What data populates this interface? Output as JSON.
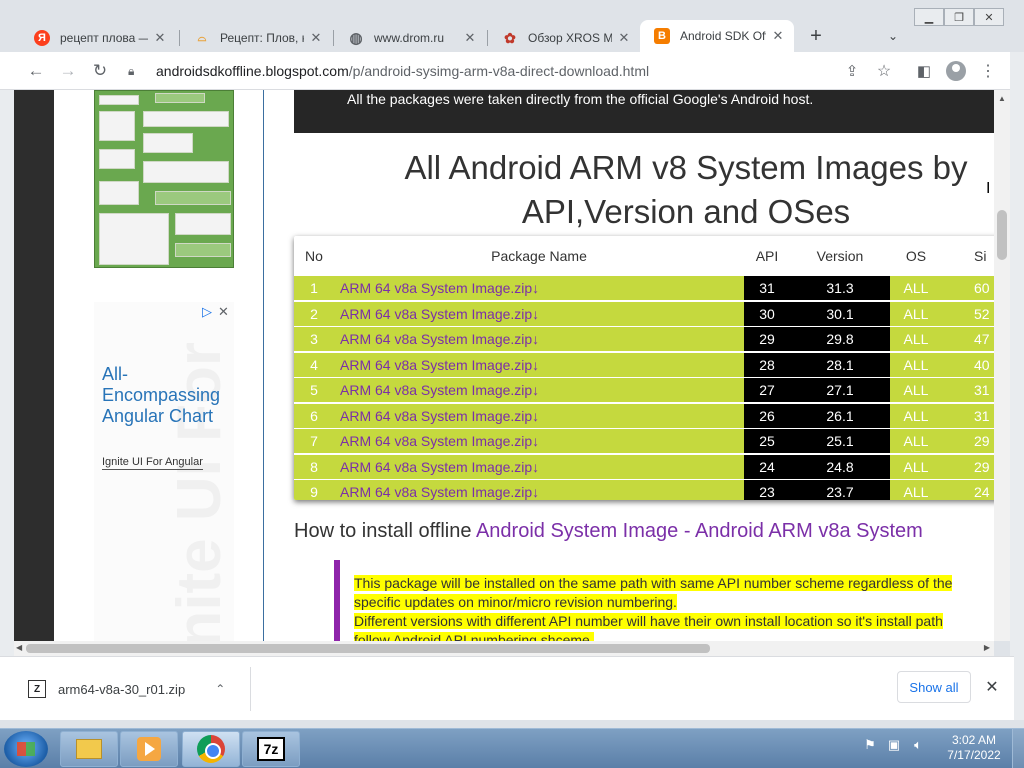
{
  "browser": {
    "tabs": [
      {
        "title": "рецепт плова —",
        "icon": "yandex-icon",
        "color": "#fc3f1d",
        "glyph": "Я"
      },
      {
        "title": "Рецепт: Плов, ко",
        "icon": "recipe-icon",
        "color": "#e8a33d",
        "glyph": "⌓"
      },
      {
        "title": "www.drom.ru",
        "icon": "globe-icon",
        "color": "#5f6368",
        "glyph": "◍"
      },
      {
        "title": "Обзор XROS MI",
        "icon": "xros-icon",
        "color": "#c0392b",
        "glyph": "✿"
      },
      {
        "title": "Android SDK Off",
        "icon": "blogger-icon",
        "color": "#f57d00",
        "glyph": "B"
      }
    ],
    "new_tab": "+",
    "url_host": "androidsdkoffline.blogspot.com",
    "url_path": "/p/android-sysimg-arm-v8a-direct-download.html"
  },
  "sidebar_ad": {
    "title": "All-Encompassing Angular Chart",
    "link": "Ignite UI For Angular",
    "watermark": "Ignite UI For"
  },
  "page": {
    "notice": "All the packages were taken directly from the official Google's Android host.",
    "heading_line1": "All Android ARM v8 System Images by",
    "heading_line2": "API,Version and OSes",
    "table": {
      "headers": {
        "no": "No",
        "name": "Package Name",
        "api": "API",
        "version": "Version",
        "os": "OS",
        "size": "Si"
      },
      "rows": [
        {
          "no": "1",
          "name": "ARM 64 v8a System Image.zip↓",
          "api": "31",
          "version": "31.3",
          "os": "ALL",
          "size": "60"
        },
        {
          "no": "2",
          "name": "ARM 64 v8a System Image.zip↓",
          "api": "30",
          "version": "30.1",
          "os": "ALL",
          "size": "52"
        },
        {
          "no": "3",
          "name": "ARM 64 v8a System Image.zip↓",
          "api": "29",
          "version": "29.8",
          "os": "ALL",
          "size": "47"
        },
        {
          "no": "4",
          "name": "ARM 64 v8a System Image.zip↓",
          "api": "28",
          "version": "28.1",
          "os": "ALL",
          "size": "40"
        },
        {
          "no": "5",
          "name": "ARM 64 v8a System Image.zip↓",
          "api": "27",
          "version": "27.1",
          "os": "ALL",
          "size": "31"
        },
        {
          "no": "6",
          "name": "ARM 64 v8a System Image.zip↓",
          "api": "26",
          "version": "26.1",
          "os": "ALL",
          "size": "31"
        },
        {
          "no": "7",
          "name": "ARM 64 v8a System Image.zip↓",
          "api": "25",
          "version": "25.1",
          "os": "ALL",
          "size": "29"
        },
        {
          "no": "8",
          "name": "ARM 64 v8a System Image.zip↓",
          "api": "24",
          "version": "24.8",
          "os": "ALL",
          "size": "29"
        },
        {
          "no": "9",
          "name": "ARM 64 v8a System Image.zip↓",
          "api": "23",
          "version": "23.7",
          "os": "ALL",
          "size": "24"
        }
      ]
    },
    "howto_prefix": "How to install offline ",
    "howto_link": "Android System Image - Android ARM v8a System",
    "note_line1": "This package will be installed on the same path with same API number scheme regardless of the",
    "note_line2": "specific updates on minor/micro revision numbering.",
    "note_line3": "Different versions with different API number will have their own install location so it's install path",
    "note_line4": "follow Android API numbering shceme."
  },
  "downloads": {
    "file": "arm64-v8a-30_r01.zip",
    "show_all": "Show all"
  },
  "taskbar": {
    "time": "3:02 AM",
    "date": "7/17/2022"
  },
  "colors": {
    "row_green": "#c5d93e",
    "link_purple": "#7b2fa8",
    "note_bar": "#8e24aa",
    "highlight": "#ffff00"
  }
}
